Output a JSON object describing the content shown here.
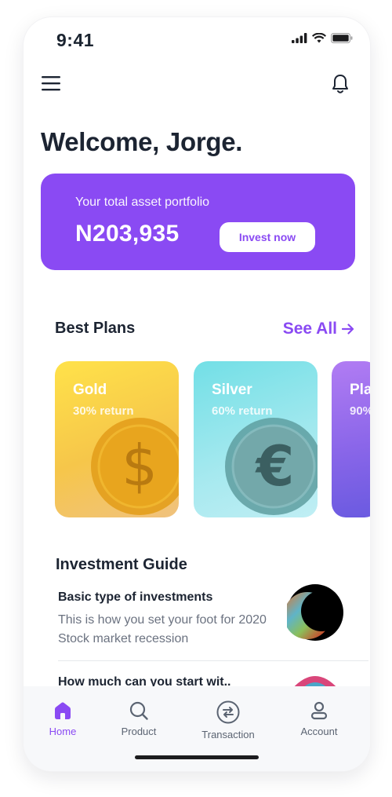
{
  "status_bar": {
    "time": "9:41"
  },
  "header": {
    "welcome": "Welcome, Jorge."
  },
  "portfolio": {
    "label": "Your total asset portfolio",
    "value": "N203,935",
    "invest_label": "Invest now"
  },
  "best_plans": {
    "title": "Best Plans",
    "see_all": "See All",
    "plans": [
      {
        "name": "Gold",
        "return": "30% return",
        "icon": "dollar-coin-icon"
      },
      {
        "name": "Silver",
        "return": "60% return",
        "icon": "euro-coin-icon"
      },
      {
        "name": "Pla",
        "return": "90%",
        "icon": "platinum-card"
      }
    ]
  },
  "investment_guide": {
    "title": "Investment Guide",
    "items": [
      {
        "heading": "Basic type of investments",
        "description": "This is how you set your foot for 2020 Stock market recession"
      },
      {
        "heading": "How much can you start wit..",
        "description": ""
      }
    ]
  },
  "tabbar": {
    "tabs": [
      {
        "label": "Home",
        "icon": "home-icon",
        "active": true
      },
      {
        "label": "Product",
        "icon": "search-icon",
        "active": false
      },
      {
        "label": "Transaction",
        "icon": "transfer-icon",
        "active": false
      },
      {
        "label": "Account",
        "icon": "account-icon",
        "active": false
      }
    ]
  },
  "colors": {
    "accent": "#8a4af3",
    "text_dark": "#1c2432",
    "text_muted": "#6b7280",
    "gold": "#f6c64a",
    "silver": "#a6e9ef",
    "platinum": "#8a66e9"
  }
}
